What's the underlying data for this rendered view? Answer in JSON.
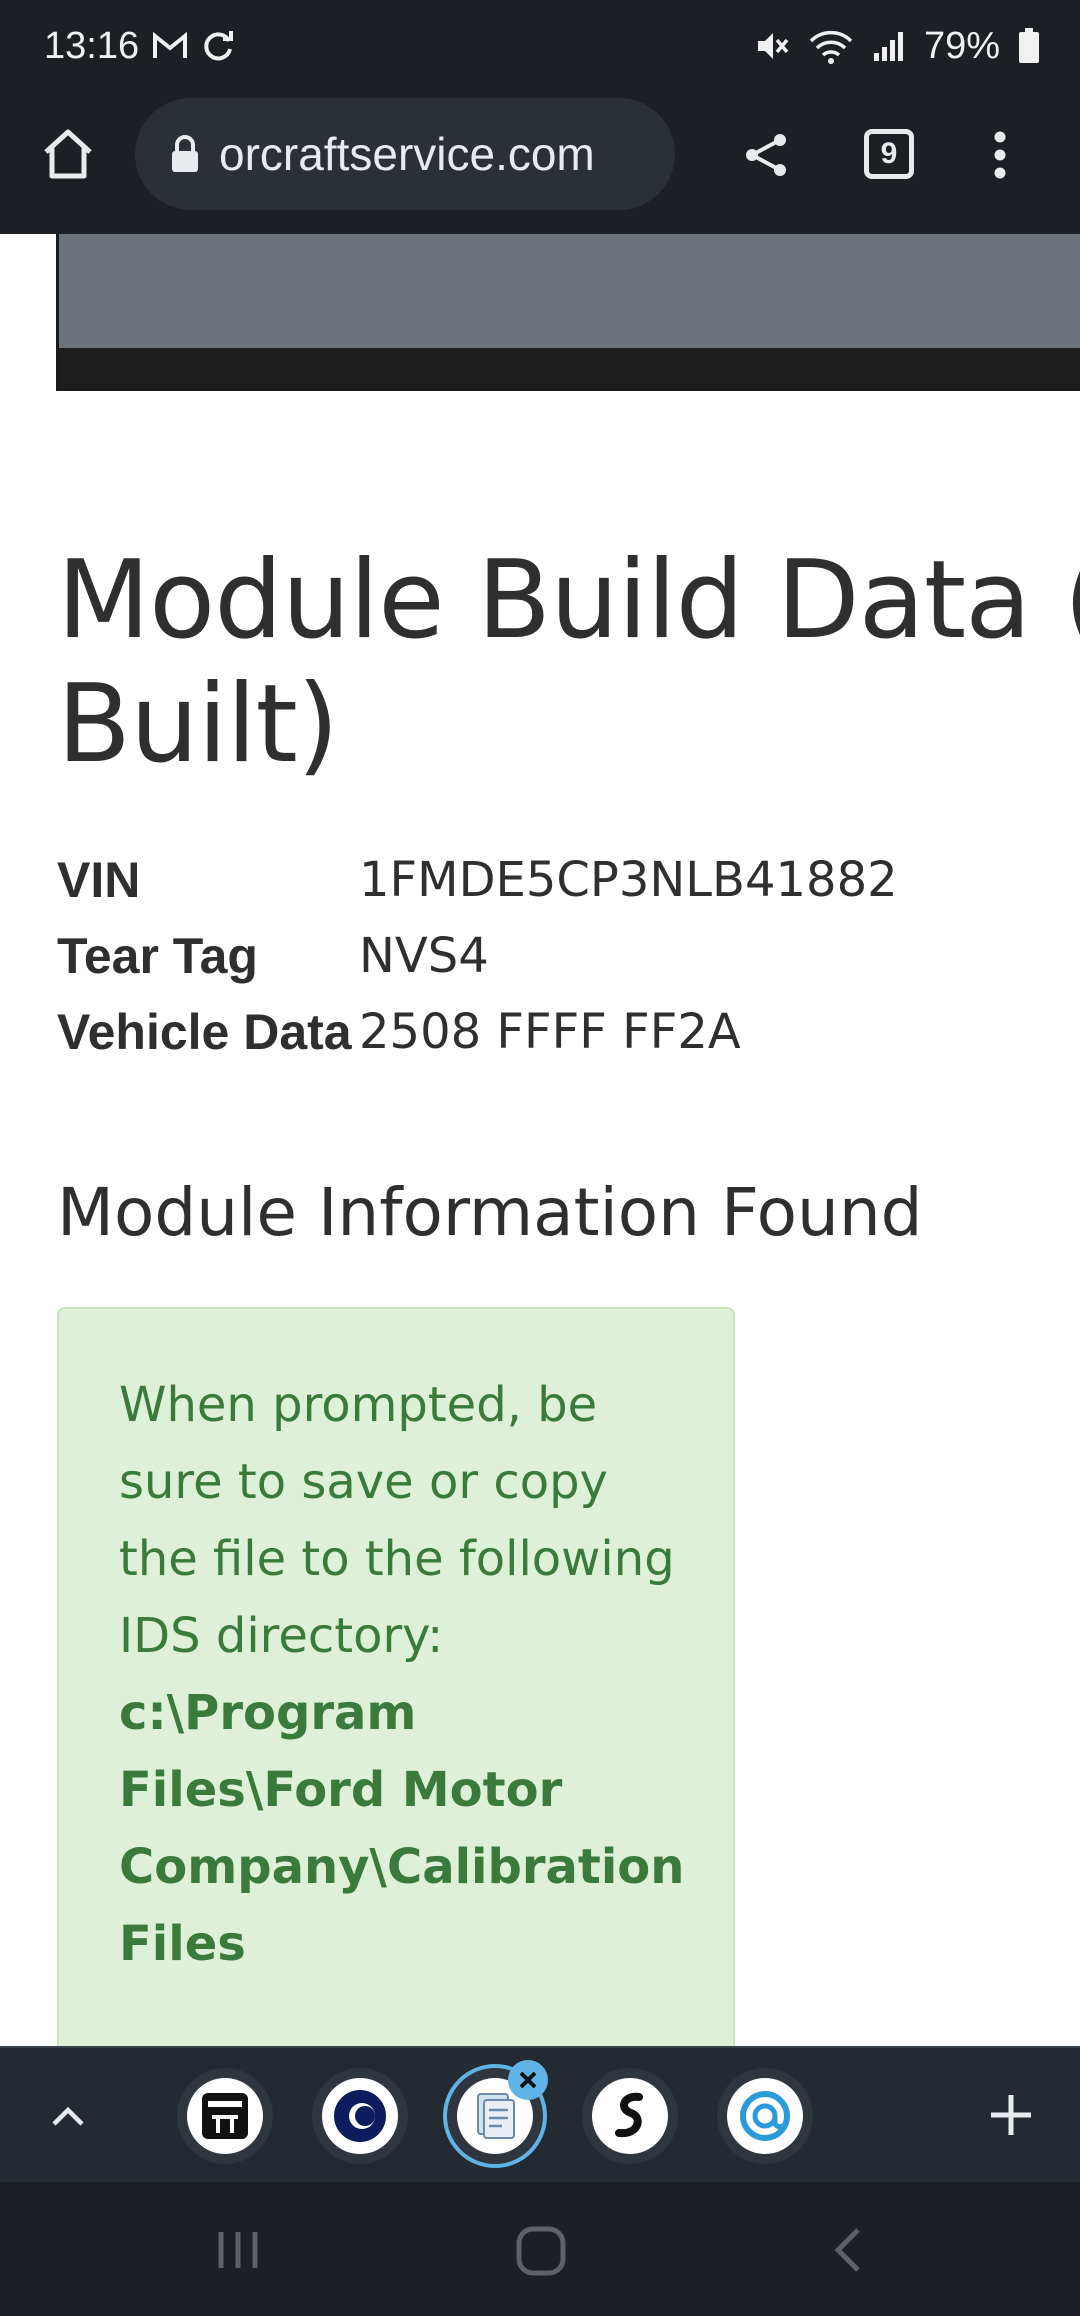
{
  "status_bar": {
    "time": "13:16",
    "battery": "79%",
    "icons": [
      "gmail-icon",
      "sync-icon",
      "mute-icon",
      "wifi-icon",
      "signal-icon",
      "battery-icon"
    ]
  },
  "browser": {
    "url": "orcraftservice.com",
    "tab_count": "9",
    "icons": [
      "home-icon",
      "lock-icon",
      "share-icon",
      "tab-switcher-icon",
      "more-vert-icon"
    ]
  },
  "page": {
    "title": "Module Build Data (As Built)",
    "info": [
      {
        "label": "VIN",
        "value": "1FMDE5CP3NLB41882"
      },
      {
        "label": "Tear Tag",
        "value": "NVS4"
      },
      {
        "label": "Vehicle Data",
        "value": "2508 FFFF FF2A"
      }
    ],
    "section_heading": "Module Information Found",
    "alert": {
      "text": "When prompted, be sure to save or copy the file to the following IDS directory:",
      "path": "c:\\Program Files\\Ford Motor Company\\Calibration Files"
    }
  },
  "tab_strip": {
    "icons": [
      "chevron-up-icon",
      "tab-favicon-1",
      "tab-favicon-2",
      "tab-favicon-3-active",
      "tab-favicon-4",
      "tab-favicon-5",
      "new-tab-icon"
    ]
  },
  "nav_bar": {
    "icons": [
      "recents-icon",
      "home-nav-icon",
      "back-icon"
    ]
  },
  "colors": {
    "chrome_bg": "#1c2025",
    "alert_bg": "#dff0d8",
    "alert_text": "#3a7a3c",
    "text": "#2f2f2f"
  }
}
